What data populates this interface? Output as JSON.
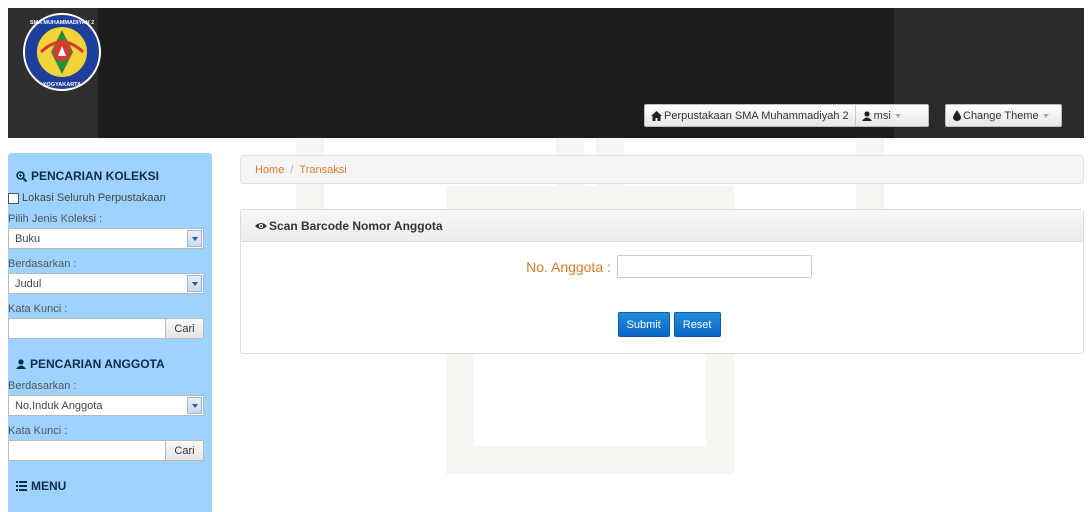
{
  "header": {
    "logo_text_top": "SMA MUHAMMADIYAH 2",
    "logo_text_bottom": "YOGYAKARTA",
    "site_link": "Perpustakaan SMA Muhammadiyah 2",
    "user_menu": "msi",
    "theme_button": "Change Theme"
  },
  "sidebar": {
    "koleksi_title": "PENCARIAN KOLEKSI",
    "lokasi_label": "Lokasi Seluruh Perpustakaan",
    "jenis_label": "Pilih Jenis Koleksi :",
    "jenis_value": "Buku",
    "berdasarkan_label": "Berdasarkan :",
    "berdasarkan_value": "Judul",
    "kata_kunci_label": "Kata Kunci :",
    "cari_label": "Cari",
    "anggota_title": "PENCARIAN ANGGOTA",
    "anggota_berdasarkan_label": "Berdasarkan :",
    "anggota_berdasarkan_value": "No.Induk Anggota",
    "anggota_kata_kunci_label": "Kata Kunci :",
    "anggota_cari_label": "Cari",
    "menu_title": "MENU"
  },
  "breadcrumb": {
    "home": "Home",
    "separator": "/",
    "current": "Transaksi"
  },
  "panel": {
    "title": "Scan Barcode Nomor Anggota",
    "field_label": "No. Anggota :",
    "submit_label": "Submit",
    "reset_label": "Reset"
  },
  "colors": {
    "accent_orange": "#e07b2a",
    "sidebar_blue": "#9fd3ff",
    "button_blue": "#0c63c2",
    "header_dark": "#1c1c1c"
  }
}
